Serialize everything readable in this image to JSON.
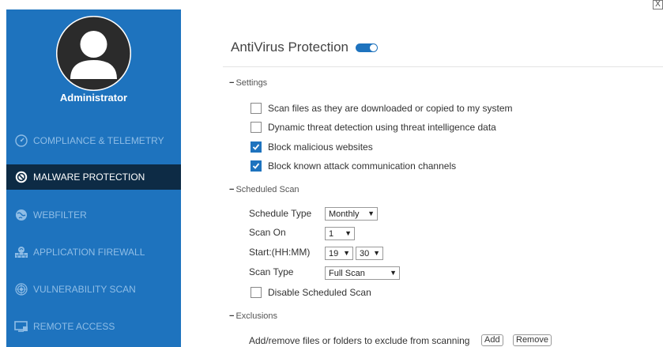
{
  "window": {
    "close_label": "X"
  },
  "sidebar": {
    "user_name": "Administrator",
    "items": [
      {
        "label": "COMPLIANCE & TELEMETRY",
        "icon": "gauge-icon",
        "active": false
      },
      {
        "label": "MALWARE PROTECTION",
        "icon": "shield-ban-icon",
        "active": true
      },
      {
        "label": "WEBFILTER",
        "icon": "globe-icon",
        "active": false
      },
      {
        "label": "APPLICATION FIREWALL",
        "icon": "firewall-icon",
        "active": false
      },
      {
        "label": "VULNERABILITY SCAN",
        "icon": "radar-icon",
        "active": false
      },
      {
        "label": "REMOTE ACCESS",
        "icon": "monitor-icon",
        "active": false
      }
    ]
  },
  "main": {
    "title": "AntiVirus Protection",
    "toggle_on": true,
    "settings": {
      "header": "Settings",
      "options": [
        {
          "label": "Scan files as they are downloaded or copied to my system",
          "checked": false
        },
        {
          "label": "Dynamic threat detection using threat intelligence data",
          "checked": false
        },
        {
          "label": "Block malicious websites",
          "checked": true
        },
        {
          "label": "Block known attack communication channels",
          "checked": true
        }
      ]
    },
    "scheduled_scan": {
      "header": "Scheduled Scan",
      "schedule_type_label": "Schedule Type",
      "schedule_type_value": "Monthly",
      "scan_on_label": "Scan On",
      "scan_on_value": "1",
      "start_label": "Start:(HH:MM)",
      "start_hour": "19",
      "start_minute": "30",
      "scan_type_label": "Scan Type",
      "scan_type_value": "Full Scan",
      "disable_label": "Disable Scheduled Scan",
      "disable_checked": false
    },
    "exclusions": {
      "header": "Exclusions",
      "text": "Add/remove files or folders to exclude from scanning",
      "add_label": "Add",
      "remove_label": "Remove"
    }
  },
  "colors": {
    "sidebar": "#1e73be",
    "active_item": "#0d2b45",
    "accent": "#1e73be"
  }
}
